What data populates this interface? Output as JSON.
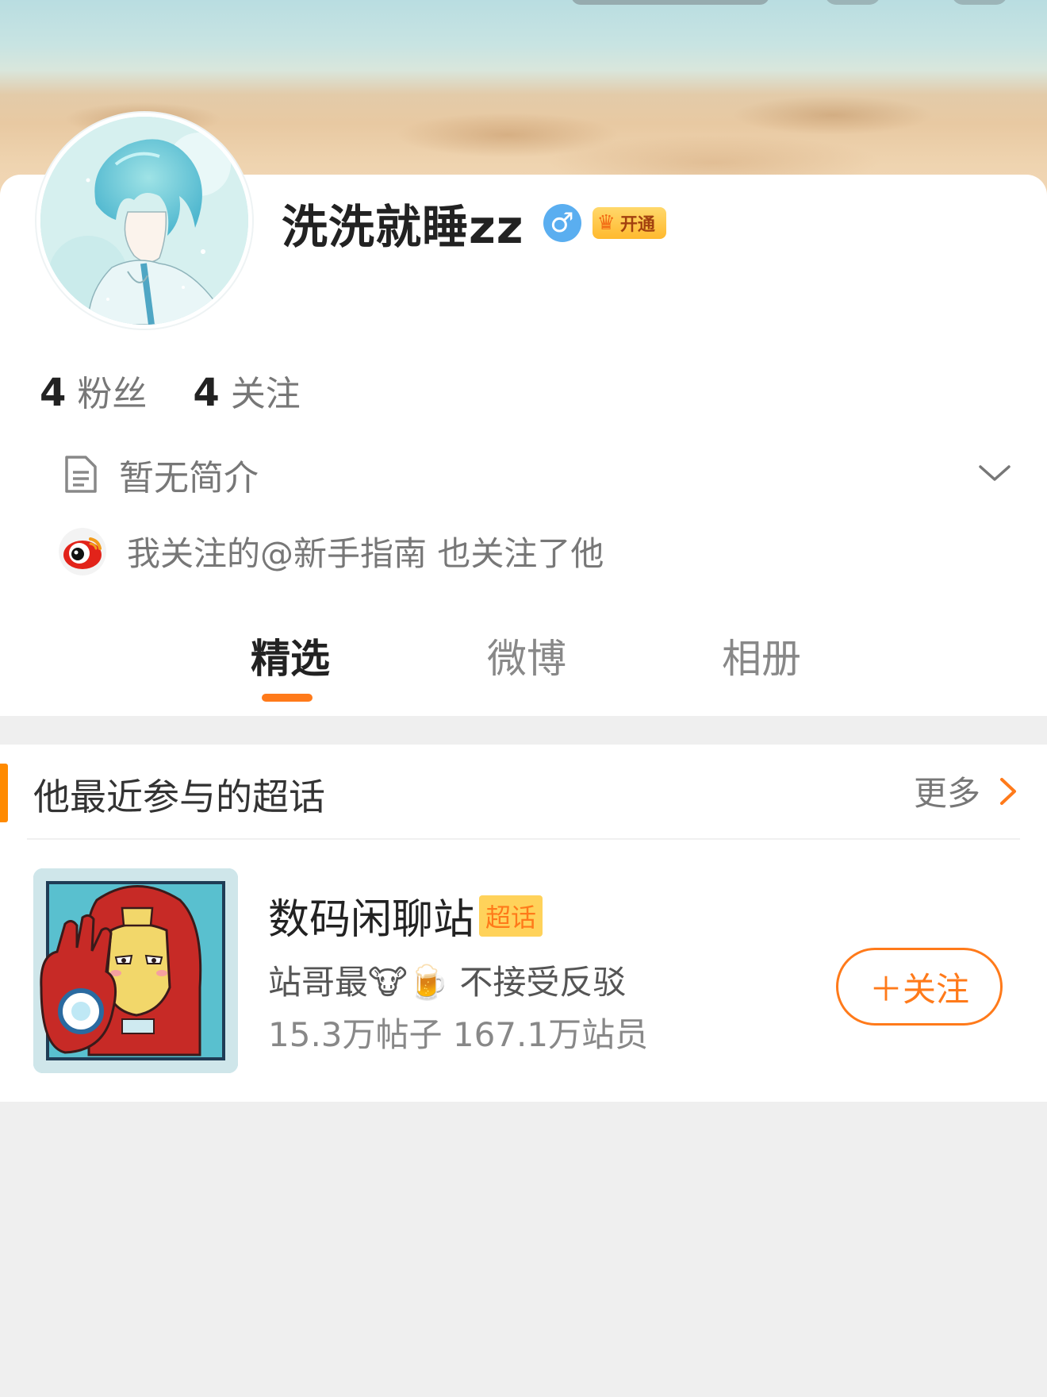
{
  "profile": {
    "username": "洗洗就睡zz",
    "gender_symbol": "♂",
    "vip_label": "开通",
    "fans_count": "4",
    "fans_label": "粉丝",
    "following_count": "4",
    "following_label": "关注",
    "bio": "暂无简介",
    "mutual_text": "我关注的@新手指南 也关注了他"
  },
  "tabs": [
    {
      "label": "精选",
      "active": true
    },
    {
      "label": "微博",
      "active": false
    },
    {
      "label": "相册",
      "active": false
    }
  ],
  "super_topics": {
    "title": "他最近参与的超话",
    "more_label": "更多",
    "items": [
      {
        "name": "数码闲聊站",
        "tag": "超话",
        "desc": "站哥最🐮🍺 不接受反驳",
        "stats": "15.3万帖子 167.1万站员",
        "follow_label": "＋关注"
      }
    ]
  },
  "icons": {
    "bio": "document-icon",
    "expand": "chevron-down-icon",
    "more": "chevron-right-icon",
    "mutual_avatar": "weibo-guide-avatar"
  },
  "colors": {
    "accent": "#ff7a1a",
    "background": "#efefef",
    "gender_badge": "#5aaef0",
    "tag_bg": "#ffd25a"
  }
}
